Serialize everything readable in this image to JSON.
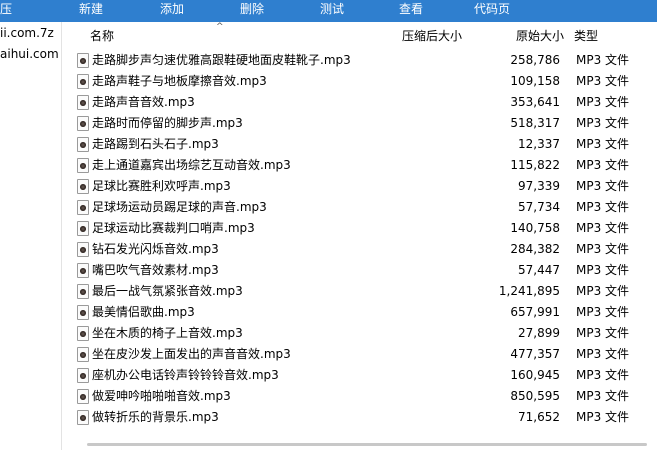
{
  "toolbar": {
    "items": [
      "压",
      "新建",
      "添加",
      "删除",
      "测试",
      "查看",
      "代码页"
    ]
  },
  "left_pane": {
    "items": [
      "ii.com.7z",
      "aihui.com"
    ]
  },
  "columns": {
    "name": "名称",
    "packed": "压缩后大小",
    "original": "原始大小",
    "type": "类型"
  },
  "files": [
    {
      "name": "走路脚步声匀速优雅高跟鞋硬地面皮鞋靴子.mp3",
      "size": "258,786",
      "type": "MP3 文件"
    },
    {
      "name": "走路声鞋子与地板摩擦音效.mp3",
      "size": "109,158",
      "type": "MP3 文件"
    },
    {
      "name": "走路声音音效.mp3",
      "size": "353,641",
      "type": "MP3 文件"
    },
    {
      "name": "走路时而停留的脚步声.mp3",
      "size": "518,317",
      "type": "MP3 文件"
    },
    {
      "name": "走路踢到石头石子.mp3",
      "size": "12,337",
      "type": "MP3 文件"
    },
    {
      "name": "走上通道嘉宾出场综艺互动音效.mp3",
      "size": "115,822",
      "type": "MP3 文件"
    },
    {
      "name": "足球比赛胜利欢呼声.mp3",
      "size": "97,339",
      "type": "MP3 文件"
    },
    {
      "name": "足球场运动员踢足球的声音.mp3",
      "size": "57,734",
      "type": "MP3 文件"
    },
    {
      "name": "足球运动比赛裁判口哨声.mp3",
      "size": "140,758",
      "type": "MP3 文件"
    },
    {
      "name": "钻石发光闪烁音效.mp3",
      "size": "284,382",
      "type": "MP3 文件"
    },
    {
      "name": "嘴巴吹气音效素材.mp3",
      "size": "57,447",
      "type": "MP3 文件"
    },
    {
      "name": "最后一战气氛紧张音效.mp3",
      "size": "1,241,895",
      "type": "MP3 文件"
    },
    {
      "name": "最美情侣歌曲.mp3",
      "size": "657,991",
      "type": "MP3 文件"
    },
    {
      "name": "坐在木质的椅子上音效.mp3",
      "size": "27,899",
      "type": "MP3 文件"
    },
    {
      "name": "坐在皮沙发上面发出的声音音效.mp3",
      "size": "477,357",
      "type": "MP3 文件"
    },
    {
      "name": "座机办公电话铃声铃铃铃音效.mp3",
      "size": "160,945",
      "type": "MP3 文件"
    },
    {
      "name": "做爱呻吟啪啪啪音效.mp3",
      "size": "850,595",
      "type": "MP3 文件"
    },
    {
      "name": "做转折乐的背景乐.mp3",
      "size": "71,652",
      "type": "MP3 文件"
    }
  ],
  "icons": {
    "file": "mp3-file-icon",
    "sort": "sort-ascending-icon"
  },
  "colors": {
    "toolbar_bg": "#2f7fcf",
    "toolbar_text": "#ffffff"
  }
}
